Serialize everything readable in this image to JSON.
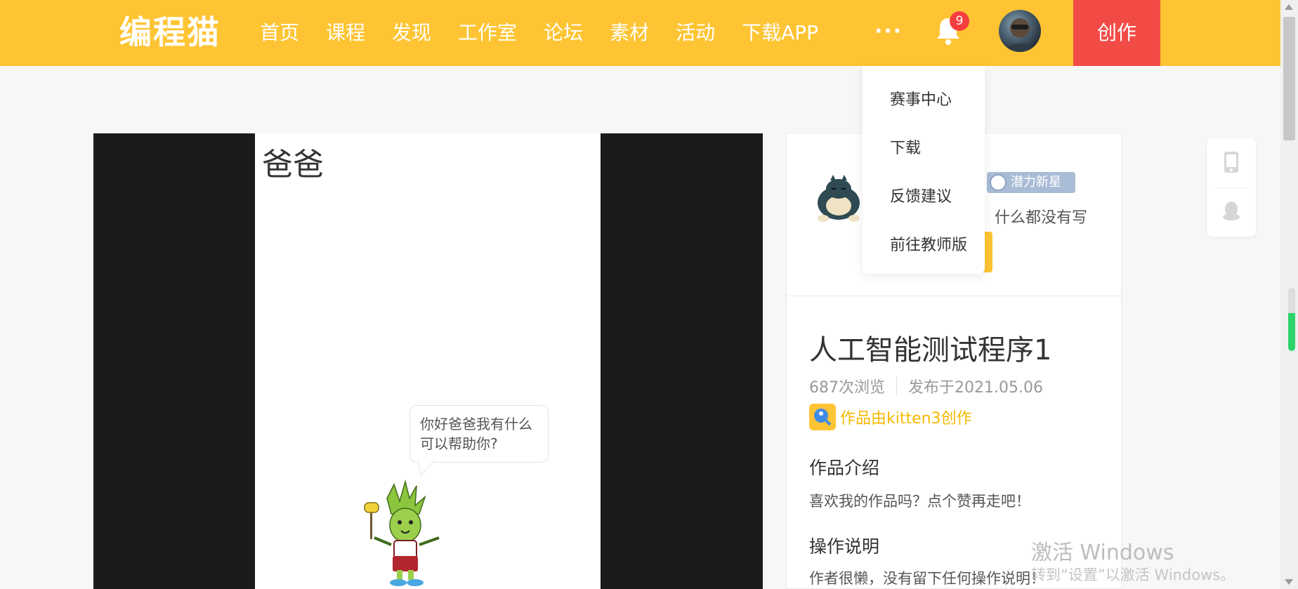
{
  "header": {
    "logo": "编程猫",
    "nav": [
      "首页",
      "课程",
      "发现",
      "工作室",
      "论坛",
      "素材",
      "活动",
      "下载APP"
    ],
    "more": "···",
    "notification_count": "9",
    "create_label": "创作",
    "colors": {
      "bar": "#fec433",
      "create": "#f24b46",
      "badge": "#f53e3e"
    }
  },
  "dropdown": {
    "items": [
      "赛事中心",
      "下载",
      "反馈建议",
      "前往教师版"
    ]
  },
  "player": {
    "stage_title": "爸爸",
    "bubble_line1": "你好爸爸我有什么",
    "bubble_line2": "可以帮助你?"
  },
  "author": {
    "level": "潜力新星",
    "signature": "什么都没有写"
  },
  "work": {
    "title": "人工智能测试程序1",
    "views": "687次浏览",
    "published": "发布于2021.05.06",
    "made_by": "作品由kitten3创作",
    "intro_title": "作品介绍",
    "intro_text": "喜欢我的作品吗？点个赞再走吧！",
    "ops_title": "操作说明",
    "ops_text": "作者很懒，没有留下任何操作说明！"
  },
  "side": {
    "icons": [
      "tablet-icon",
      "qq-icon"
    ]
  },
  "watermark": {
    "line1": "激活 Windows",
    "line2": "转到“设置”以激活 Windows。"
  }
}
